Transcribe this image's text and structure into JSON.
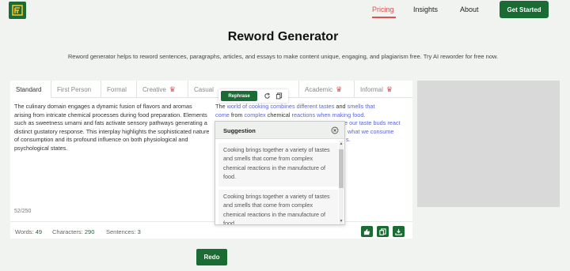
{
  "header": {
    "nav": [
      {
        "label": "Pricing",
        "active": true
      },
      {
        "label": "Insights",
        "active": false
      },
      {
        "label": "About",
        "active": false
      }
    ],
    "cta_label": "Get Started"
  },
  "title": "Reword Generator",
  "description": "Reword generator helps to reword sentences, paragraphs, articles, and essays to make content unique, engaging, and plagiarism free. Try AI reworder for free now.",
  "tabs": [
    {
      "label": "Standard",
      "premium": false,
      "active": true
    },
    {
      "label": "First Person",
      "premium": false,
      "active": false
    },
    {
      "label": "Formal",
      "premium": false,
      "active": false
    },
    {
      "label": "Creative",
      "premium": true,
      "active": false
    },
    {
      "label": "Casual",
      "premium": false,
      "active": false
    },
    {
      "label": "Academic",
      "premium": true,
      "active": false
    },
    {
      "label": "Informal",
      "premium": true,
      "active": false
    }
  ],
  "input_text": "The culinary domain engages a dynamic fusion of flavors and aromas arising from intricate chemical processes during food preparation. Elements such as sweetness umami and fats activate sensory pathways generating a distinct gustatory response. This interplay highlights the sophisticated nature of consumption and its profound influence on both physiological and psychological states.",
  "char_counter": "52/250",
  "output": {
    "line1_a": "The ",
    "line1_b": "world of",
    "line1_c": " ",
    "line1_d": "cooking combines different tastes",
    "line1_e": " and ",
    "line1_f": "smells that",
    "line2_a": "come",
    "line2_b": " from ",
    "line2_c": "complex",
    "line2_d": " chemical ",
    "line2_e": "reactions when making food.",
    "line3_tail": "e our taste buds react",
    "line4_tail": "what we consume",
    "line5_tail": "s."
  },
  "toolbar": {
    "rephrase_label": "Rephrase"
  },
  "suggestion": {
    "title": "Suggestion",
    "items": [
      "Cooking brings together a variety of tastes and smells that come from complex chemical reactions in the manufacture of food.",
      "Cooking brings together a variety of tastes and smells that come from complex chemical reactions in the manufacture of food."
    ]
  },
  "stats": {
    "words_label": "Words:",
    "words": "49",
    "chars_label": "Characters:",
    "chars": "290",
    "sentences_label": "Sentences:",
    "sentences": "3"
  },
  "redo_label": "Redo",
  "colors": {
    "brand": "#1b6b34",
    "accent": "#d9534f",
    "highlight": "#5a66d6"
  }
}
